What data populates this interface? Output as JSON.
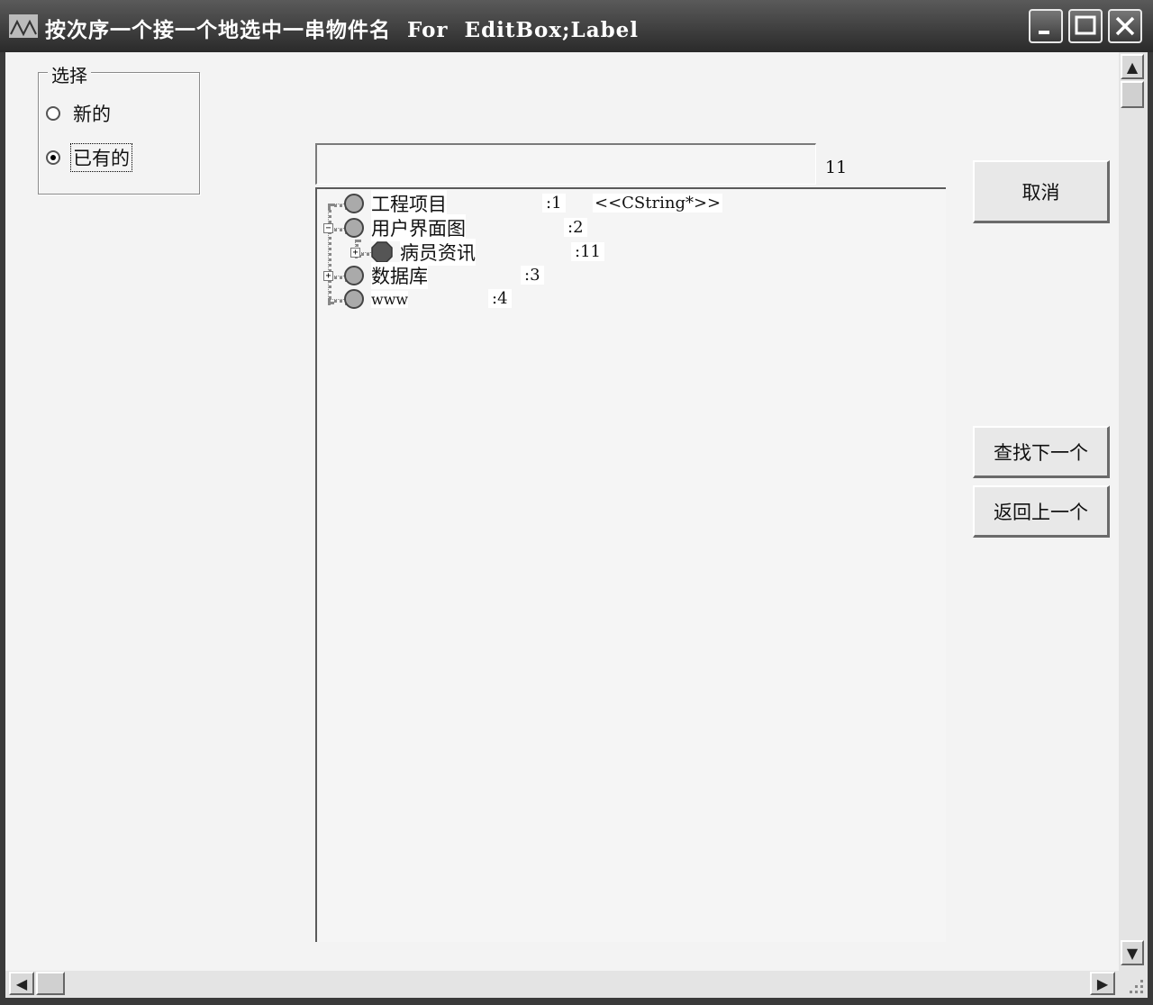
{
  "window": {
    "title": "按次序一个接一个地选中一串物件名  For  EditBox;Label",
    "minimize_glyph": "▁",
    "maximize_glyph": "□",
    "close_glyph": "✕"
  },
  "group": {
    "title": "选择",
    "options": [
      {
        "label": "新的",
        "selected": false
      },
      {
        "label": "已有的",
        "selected": true
      }
    ]
  },
  "edit": {
    "value": ""
  },
  "count": "11",
  "tree": {
    "nodes": [
      {
        "label": "工程项目",
        "id": ":1",
        "extra": "<<CString*>>",
        "level": 0,
        "expander": ""
      },
      {
        "label": "用户界面图",
        "id": ":2",
        "extra": "",
        "level": 0,
        "expander": "−"
      },
      {
        "label": "病员资讯",
        "id": ":11",
        "extra": "",
        "level": 1,
        "expander": "+"
      },
      {
        "label": "数据库",
        "id": ":3",
        "extra": "",
        "level": 0,
        "expander": "+"
      },
      {
        "label": "www",
        "id": ":4",
        "extra": "",
        "level": 0,
        "expander": ""
      }
    ]
  },
  "buttons": {
    "cancel": "取消",
    "find_next": "查找下一个",
    "go_back": "返回上一个"
  },
  "scroll": {
    "up": "▲",
    "down": "▼",
    "left": "◀",
    "right": "▶"
  },
  "icons": {
    "app": "app-icon",
    "node": "circle-icon",
    "node_selected": "octagon-icon"
  }
}
